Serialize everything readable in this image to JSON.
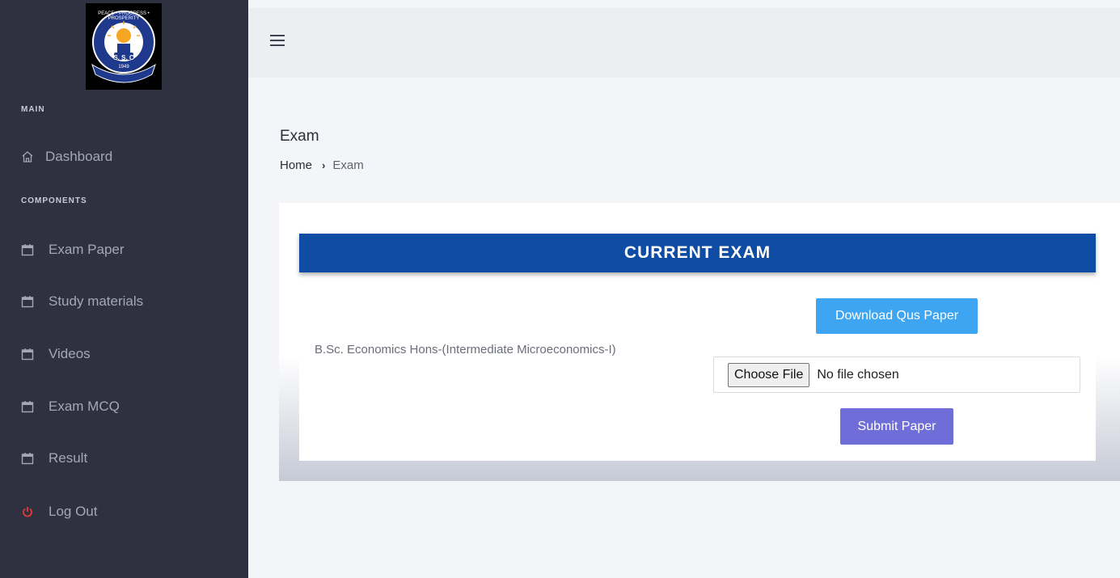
{
  "logo": {
    "top_text": "PEACE • PROGRESS • PROSPERITY",
    "initials": "S. S. C",
    "year": "1949"
  },
  "sidebar": {
    "main_label": "MAIN",
    "components_label": "COMPONENTS",
    "items": [
      {
        "label": "Dashboard",
        "icon": "home-icon"
      },
      {
        "label": "Exam Paper",
        "icon": "calendar-icon"
      },
      {
        "label": "Study materials",
        "icon": "calendar-icon"
      },
      {
        "label": "Videos",
        "icon": "calendar-icon"
      },
      {
        "label": "Exam MCQ",
        "icon": "calendar-icon"
      },
      {
        "label": "Result",
        "icon": "calendar-icon"
      },
      {
        "label": "Log Out",
        "icon": "power-icon"
      }
    ]
  },
  "page": {
    "title": "Exam",
    "breadcrumb": {
      "home": "Home",
      "separator": "›",
      "current": "Exam"
    }
  },
  "exam": {
    "header": "CURRENT EXAM",
    "course": "B.Sc. Economics Hons-(Intermediate Microeconomics-I)",
    "download_label": "Download Qus Paper",
    "choose_file_label": "Choose File",
    "file_status": "No file chosen",
    "submit_label": "Submit Paper"
  },
  "colors": {
    "sidebar_bg": "#2f3140",
    "header_blue": "#0f4da4",
    "download_btn": "#3ea5f3",
    "submit_btn": "#6f6ed8",
    "logout_red": "#e53935"
  }
}
